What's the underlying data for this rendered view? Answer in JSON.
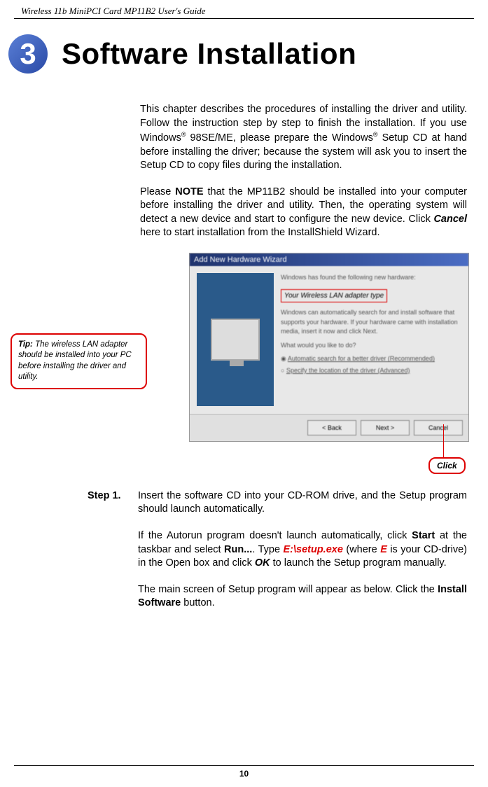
{
  "header": {
    "guide_title": "Wireless 11b MiniPCI Card MP11B2 User's Guide"
  },
  "chapter": {
    "number": "3",
    "title": "Software Installation"
  },
  "intro": {
    "p1_a": "This chapter describes the procedures of installing the driver and utility.  Follow the instruction step by step to finish the installation.  If you use Windows",
    "p1_b": " 98SE/ME, please prepare the Windows",
    "p1_c": " Setup CD at hand before installing the driver; because the system will ask you to insert the Setup CD to copy files during the installation.",
    "p2_a": "Please ",
    "p2_b": "NOTE",
    "p2_c": " that the MP11B2 should be installed into your computer before installing the driver and utility.  Then, the operating system will detect a new device and start to configure the new device.  Click ",
    "p2_d": "Cancel",
    "p2_e": " here to start installation from the InstallShield Wizard."
  },
  "tip": {
    "label": "Tip:",
    "text": " The wireless LAN adapter should be installed into your PC before installing the driver and utility."
  },
  "wizard": {
    "title": "Add New Hardware Wizard",
    "line1": "Windows has found the following new hardware:",
    "red_label": "Your Wireless LAN adapter type",
    "line2": "Windows can automatically search for and install software that supports your hardware. If your hardware came with installation media, insert it now and click Next.",
    "line3": "What would you like to do?",
    "radio1": "Automatic search for a better driver (Recommended)",
    "radio2": "Specify the location of the driver (Advanced)",
    "btn_back": "< Back",
    "btn_next": "Next >",
    "btn_cancel": "Cancel"
  },
  "click_label": "Click",
  "step1": {
    "label": "Step 1.",
    "p1": "Insert the software CD into your CD-ROM drive, and the Setup program should launch automatically.",
    "p2_a": "If the Autorun program doesn't launch automatically, click ",
    "p2_b": "Start",
    "p2_c": " at the taskbar and select ",
    "p2_d": "Run...",
    "p2_e": ".  Type ",
    "p2_f": "E:\\setup.exe",
    "p2_g": " (where ",
    "p2_h": "E",
    "p2_i": " is your CD-drive) in the Open box and click ",
    "p2_j": "OK",
    "p2_k": " to launch the Setup program manually.",
    "p3_a": "The main screen of Setup program will appear as below. Click the ",
    "p3_b": "Install Software",
    "p3_c": " button."
  },
  "footer": {
    "page": "10"
  }
}
